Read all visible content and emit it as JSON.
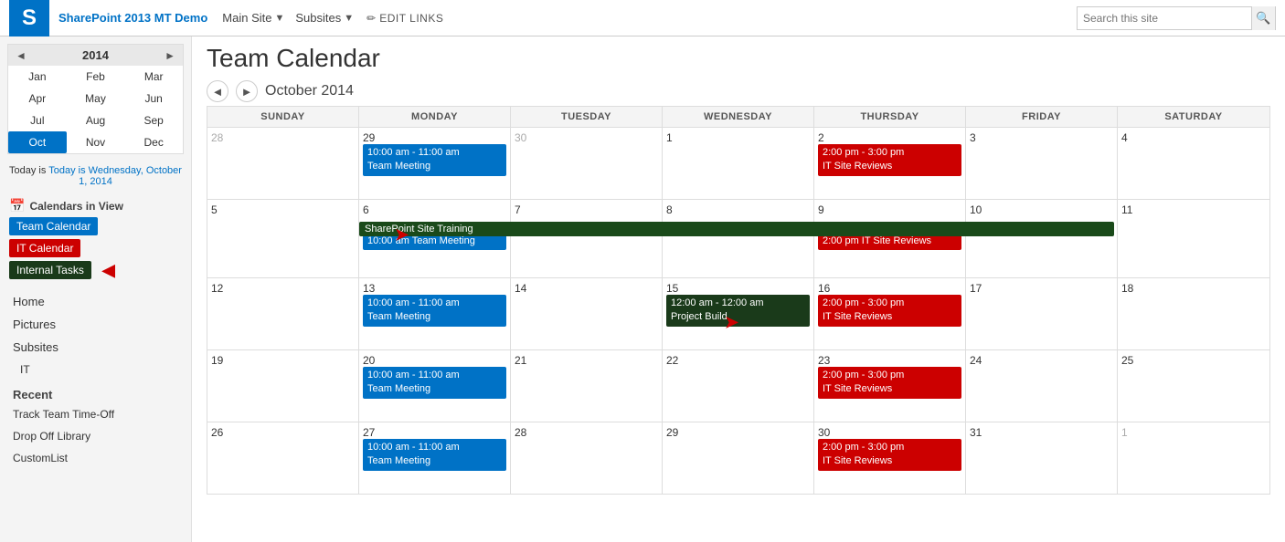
{
  "topNav": {
    "brand": "SharePoint 2013 MT Demo",
    "mainSite": "Main Site",
    "subsites": "Subsites",
    "editLinks": "EDIT LINKS",
    "search": {
      "placeholder": "Search this site"
    }
  },
  "pageHeader": {
    "title": "Team Calendar"
  },
  "calNav": {
    "prevLabel": "◄",
    "nextLabel": "►",
    "monthLabel": "October 2014",
    "prevBtn": "❮",
    "nextBtn": "❯"
  },
  "miniCal": {
    "year": "2014",
    "months": [
      "Jan",
      "Feb",
      "Mar",
      "Apr",
      "May",
      "Jun",
      "Jul",
      "Aug",
      "Sep",
      "Oct",
      "Nov",
      "Dec"
    ],
    "activeMonth": "Oct"
  },
  "todayLabel": "Today is Wednesday, October 1, 2014",
  "calendarsInView": {
    "label": "Calendars in View",
    "items": [
      {
        "name": "Team Calendar",
        "color": "blue"
      },
      {
        "name": "IT Calendar",
        "color": "red"
      },
      {
        "name": "Internal Tasks",
        "color": "dark-green"
      }
    ]
  },
  "sidebarLinks": {
    "links": [
      "Home",
      "Pictures",
      "Subsites"
    ],
    "subLinks": [
      "IT"
    ],
    "recentLabel": "Recent",
    "recentLinks": [
      "Track Team Time-Off",
      "Drop Off Library",
      "CustomList"
    ]
  },
  "calDayHeaders": [
    "SUNDAY",
    "MONDAY",
    "TUESDAY",
    "WEDNESDAY",
    "THURSDAY",
    "FRIDAY",
    "SATURDAY"
  ],
  "weeks": [
    {
      "days": [
        {
          "date": "28",
          "otherMonth": true,
          "events": []
        },
        {
          "date": "29",
          "otherMonth": false,
          "events": [
            {
              "text": "10:00 am - 11:00 am Team Meeting",
              "color": "blue"
            }
          ]
        },
        {
          "date": "30",
          "otherMonth": true,
          "events": []
        },
        {
          "date": "1",
          "otherMonth": false,
          "events": []
        },
        {
          "date": "2",
          "otherMonth": false,
          "events": [
            {
              "text": "2:00 pm - 3:00 pm IT Site Reviews",
              "color": "red"
            }
          ]
        },
        {
          "date": "3",
          "otherMonth": false,
          "events": []
        },
        {
          "date": "4",
          "otherMonth": false,
          "events": []
        }
      ],
      "spanning": null
    },
    {
      "days": [
        {
          "date": "5",
          "otherMonth": false,
          "events": []
        },
        {
          "date": "6",
          "otherMonth": false,
          "events": [
            {
              "text": "10:00 am Team Meeting",
              "color": "blue"
            }
          ]
        },
        {
          "date": "7",
          "otherMonth": false,
          "events": []
        },
        {
          "date": "8",
          "otherMonth": false,
          "events": []
        },
        {
          "date": "9",
          "otherMonth": false,
          "events": [
            {
              "text": "2:00 pm IT Site Reviews",
              "color": "red"
            }
          ]
        },
        {
          "date": "10",
          "otherMonth": false,
          "events": []
        },
        {
          "date": "11",
          "otherMonth": false,
          "events": []
        }
      ],
      "spanning": {
        "text": "SharePoint Site Training",
        "color": "dark-green",
        "startCol": 1,
        "span": 5
      }
    },
    {
      "days": [
        {
          "date": "12",
          "otherMonth": false,
          "events": []
        },
        {
          "date": "13",
          "otherMonth": false,
          "events": [
            {
              "text": "10:00 am - 11:00 am Team Meeting",
              "color": "blue"
            }
          ]
        },
        {
          "date": "14",
          "otherMonth": false,
          "events": []
        },
        {
          "date": "15",
          "otherMonth": false,
          "events": [
            {
              "text": "12:00 am - 12:00 am Project Build",
              "color": "dark-green"
            }
          ]
        },
        {
          "date": "16",
          "otherMonth": false,
          "events": [
            {
              "text": "2:00 pm - 3:00 pm IT Site Reviews",
              "color": "red"
            }
          ]
        },
        {
          "date": "17",
          "otherMonth": false,
          "events": []
        },
        {
          "date": "18",
          "otherMonth": false,
          "events": []
        }
      ],
      "spanning": null
    },
    {
      "days": [
        {
          "date": "19",
          "otherMonth": false,
          "events": []
        },
        {
          "date": "20",
          "otherMonth": false,
          "events": [
            {
              "text": "10:00 am - 11:00 am Team Meeting",
              "color": "blue"
            }
          ]
        },
        {
          "date": "21",
          "otherMonth": false,
          "events": []
        },
        {
          "date": "22",
          "otherMonth": false,
          "events": []
        },
        {
          "date": "23",
          "otherMonth": false,
          "events": [
            {
              "text": "2:00 pm - 3:00 pm IT Site Reviews",
              "color": "red"
            }
          ]
        },
        {
          "date": "24",
          "otherMonth": false,
          "events": []
        },
        {
          "date": "25",
          "otherMonth": false,
          "events": []
        }
      ],
      "spanning": null
    },
    {
      "days": [
        {
          "date": "26",
          "otherMonth": false,
          "events": []
        },
        {
          "date": "27",
          "otherMonth": false,
          "events": [
            {
              "text": "10:00 am - 11:00 am Team Meeting",
              "color": "blue"
            }
          ]
        },
        {
          "date": "28",
          "otherMonth": false,
          "events": []
        },
        {
          "date": "29",
          "otherMonth": false,
          "events": []
        },
        {
          "date": "30",
          "otherMonth": false,
          "events": [
            {
              "text": "2:00 pm - 3:00 pm IT Site Reviews",
              "color": "red"
            }
          ]
        },
        {
          "date": "31",
          "otherMonth": false,
          "events": []
        },
        {
          "date": "1",
          "otherMonth": true,
          "events": []
        }
      ],
      "spanning": null
    }
  ]
}
